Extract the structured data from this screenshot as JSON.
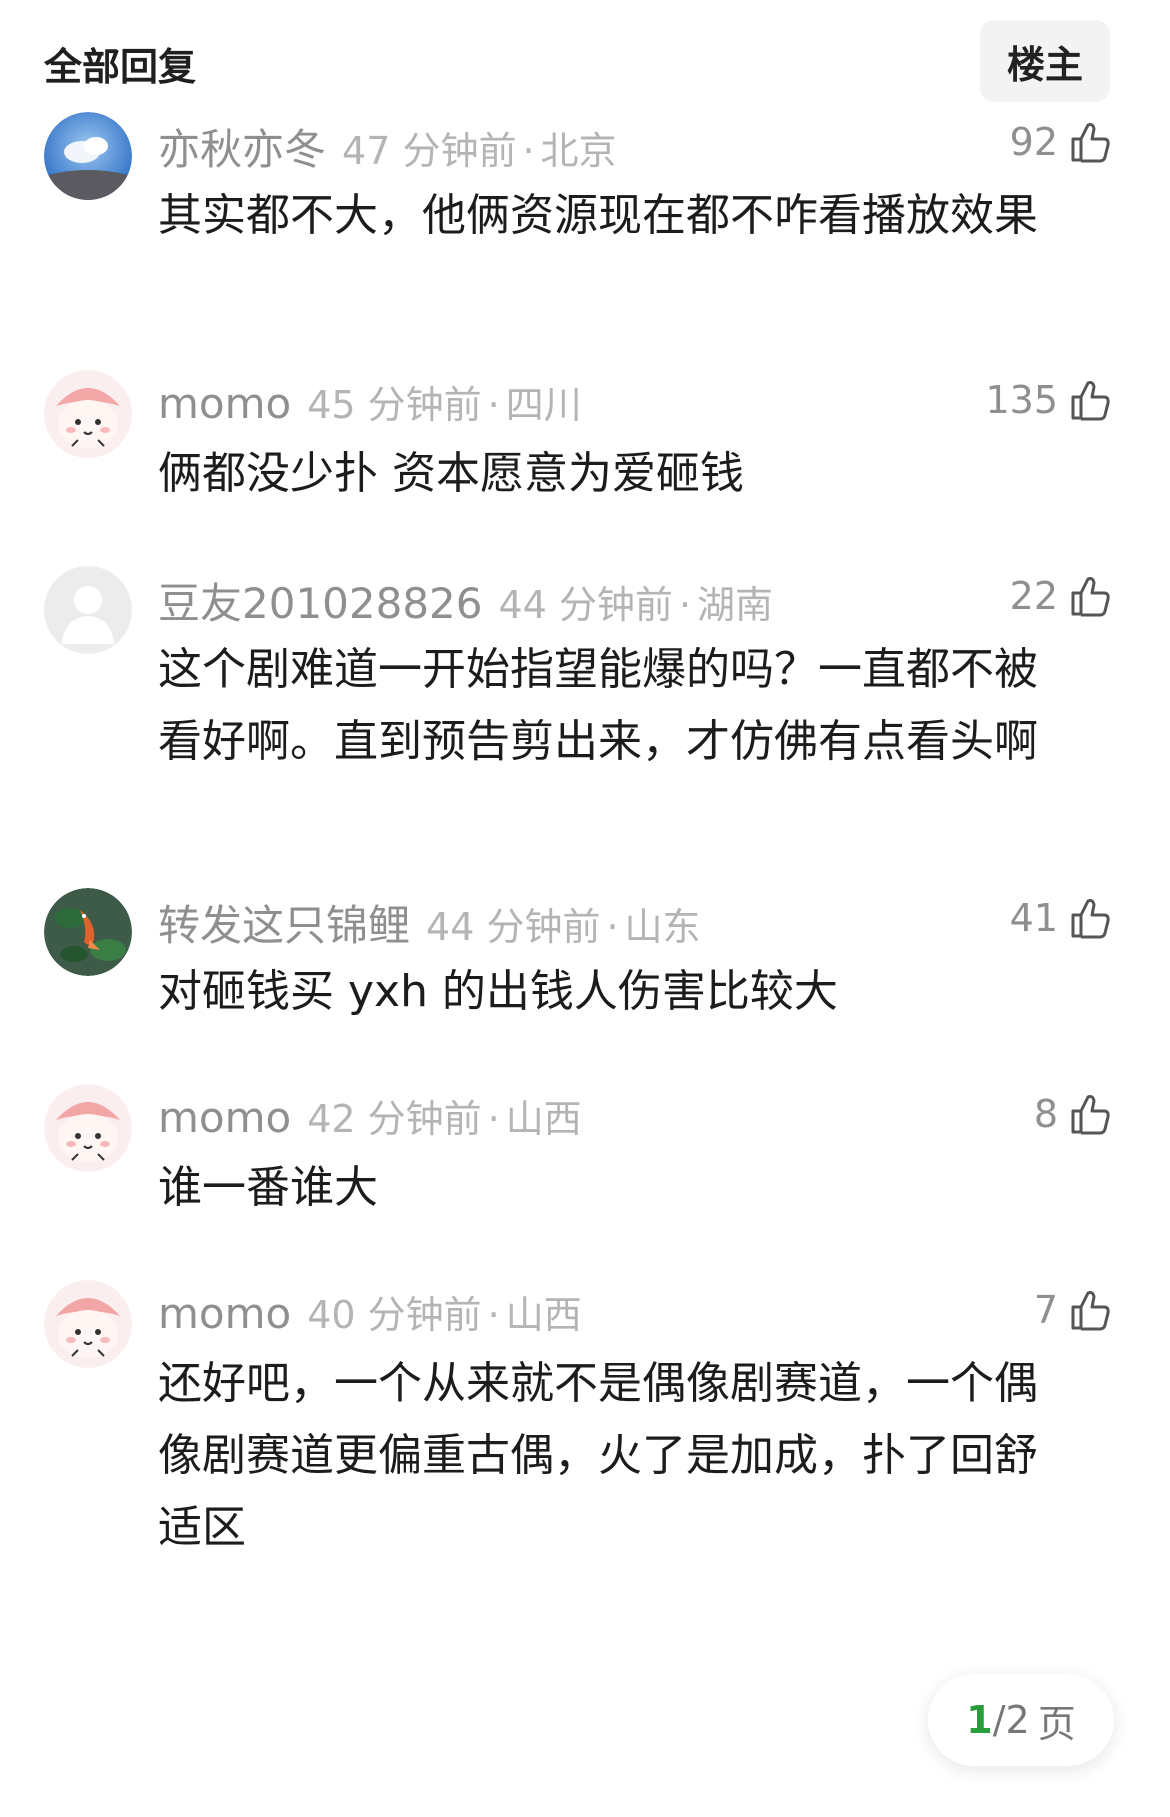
{
  "header": {
    "title": "全部回复",
    "op_button": "楼主"
  },
  "comments": [
    {
      "user": "亦秋亦冬",
      "time": "47 分钟前",
      "location": "北京",
      "likes": "92",
      "text": "其实都不大，他俩资源现在都不咋看播放效果",
      "avatar": "sky-photo"
    },
    {
      "user": "momo",
      "time": "45 分钟前",
      "location": "四川",
      "likes": "135",
      "text": "俩都没少扑 资本愿意为爱砸钱",
      "avatar": "pink-cartoon"
    },
    {
      "user": "豆友201028826",
      "time": "44 分钟前",
      "location": "湖南",
      "likes": "22",
      "text": "这个剧难道一开始指望能爆的吗？一直都不被看好啊。直到预告剪出来，才仿佛有点看头啊",
      "avatar": "default-person"
    },
    {
      "user": "转发这只锦鲤",
      "time": "44 分钟前",
      "location": "山东",
      "likes": "41",
      "text": "对砸钱买 yxh 的出钱人伤害比较大",
      "avatar": "koi-painting"
    },
    {
      "user": "momo",
      "time": "42 分钟前",
      "location": "山西",
      "likes": "8",
      "text": "谁一番谁大",
      "avatar": "pink-cartoon"
    },
    {
      "user": "momo",
      "time": "40 分钟前",
      "location": "山西",
      "likes": "7",
      "text": "还好吧，一个从来就不是偶像剧赛道，一个偶像剧赛道更偏重古偶，火了是加成，扑了回舒适区",
      "avatar": "pink-cartoon"
    }
  ],
  "pager": {
    "current": "1",
    "total": "2",
    "unit": "页",
    "separator": "/"
  },
  "colors": {
    "accent": "#2a9d3c",
    "meta": "#b4b4b4",
    "username": "#8f8f8f",
    "text": "#1c1c1c"
  },
  "icons": {
    "like": "thumbs-up-icon"
  }
}
